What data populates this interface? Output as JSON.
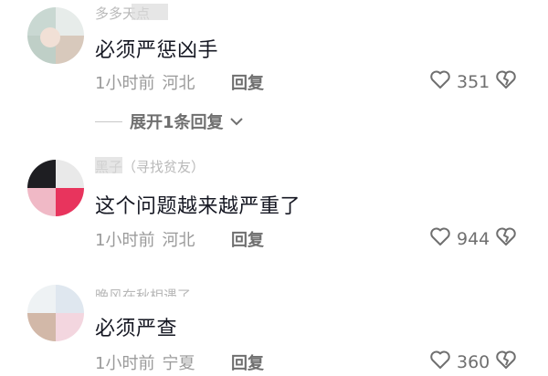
{
  "comments": [
    {
      "username": "多多天点",
      "text": "必须严惩凶手",
      "time": "1小时前",
      "location": "河北",
      "reply_label": "回复",
      "likes": "351"
    },
    {
      "username": "黑子（寻找贫友）",
      "text": "这个问题越来越严重了",
      "time": "1小时前",
      "location": "河北",
      "reply_label": "回复",
      "likes": "944"
    },
    {
      "username": "晚风在秋相遇了",
      "text": "必须严查",
      "time": "1小时前",
      "location": "宁夏",
      "reply_label": "回复",
      "likes": "360"
    }
  ],
  "expand_replies": "展开1条回复",
  "icons": {
    "like": "heart-outline-icon",
    "dislike": "broken-heart-icon",
    "expand": "chevron-down-icon"
  },
  "colors": {
    "text": "#161823",
    "meta": "#9a9a9a",
    "action": "#6f6f6f"
  }
}
